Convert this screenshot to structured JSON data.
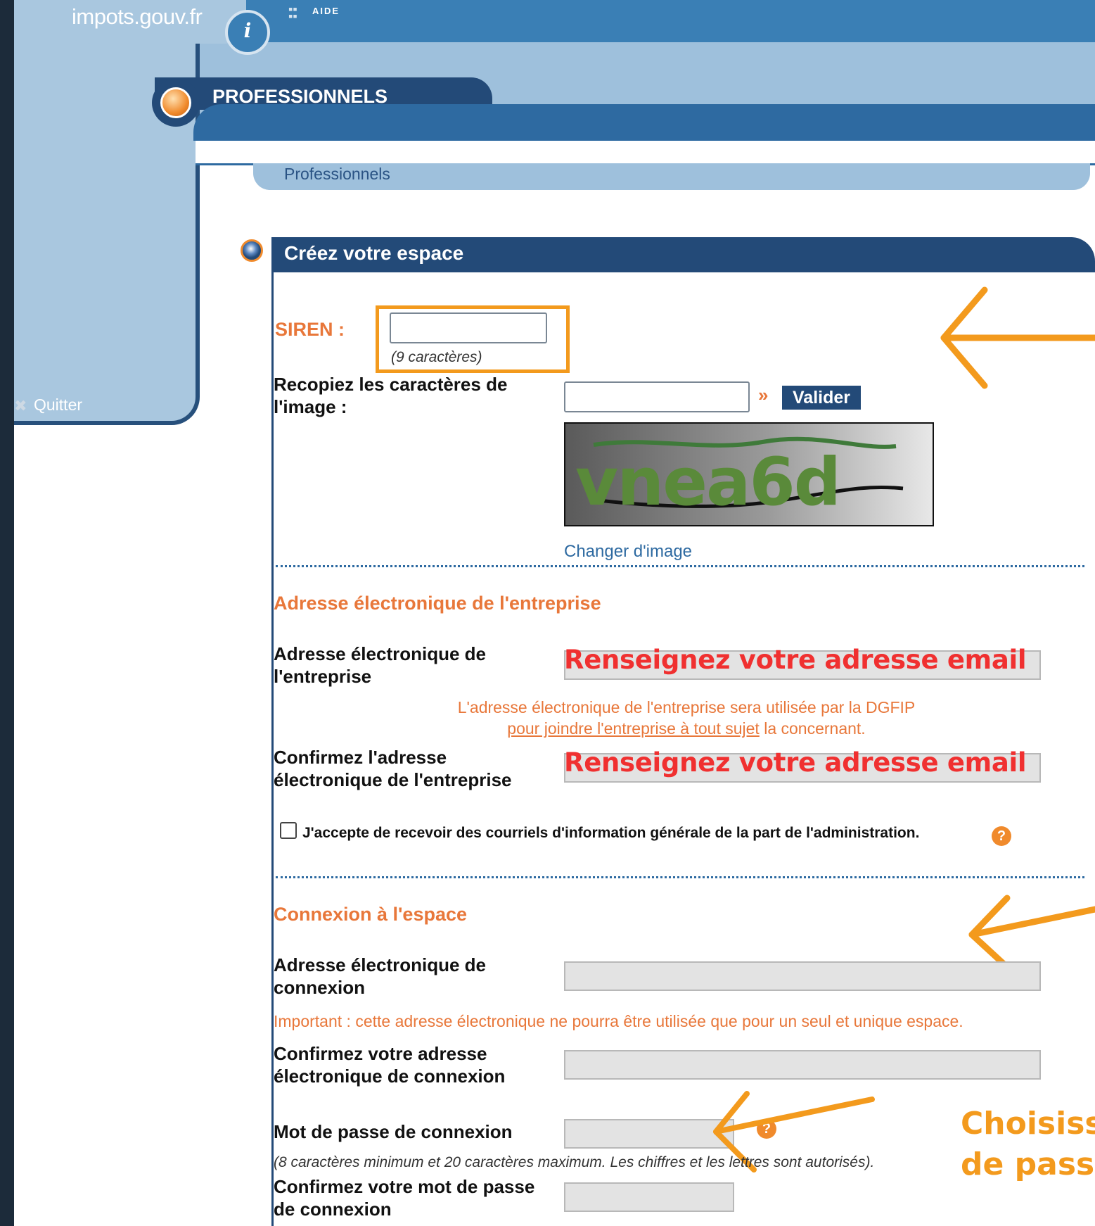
{
  "header": {
    "site_name": "impots.gouv.fr",
    "info_icon": "i",
    "aide_label": "AIDE",
    "section_label": "PROFESSIONNELS"
  },
  "breadcrumb": {
    "text": "Professionnels"
  },
  "sidebar": {
    "quit_label": "Quitter",
    "quit_icon": "✖"
  },
  "form": {
    "title": "Créez votre espace",
    "siren": {
      "label": "SIREN :",
      "value": "",
      "hint": "(9 caractères)"
    },
    "captcha": {
      "label_line1": "Recopiez les caractères de",
      "label_line2": "l'image :",
      "value": "",
      "validate_label": "Valider",
      "arrow_glyph": "»",
      "image_text": "vnea6d",
      "change_label": "Changer d'image"
    },
    "company_email_section": {
      "heading": "Adresse électronique de l'entreprise",
      "email_label_line1": "Adresse électronique de",
      "email_label_line2": "l'entreprise",
      "email_value": "",
      "note_line1": "L'adresse électronique de l'entreprise sera utilisée par la DGFIP",
      "note_link": "pour joindre l'entreprise à tout sujet",
      "note_line2_rest": " la concernant.",
      "confirm_label_line1": "Confirmez l'adresse",
      "confirm_label_line2": "électronique de l'entreprise",
      "confirm_value": "",
      "consent_label": "J'accepte de recevoir des courriels d'information générale de la part de l'administration.",
      "consent_checked": false,
      "help_glyph": "?"
    },
    "connection_section": {
      "heading": "Connexion à l'espace",
      "email_label_line1": "Adresse électronique de",
      "email_label_line2": "connexion",
      "email_value": "",
      "important_note": "Important : cette adresse électronique ne pourra être utilisée que pour un seul et unique espace.",
      "confirm_label_line1": "Confirmez votre adresse",
      "confirm_label_line2": "électronique de connexion",
      "confirm_value": "",
      "password_label": "Mot de passe de connexion",
      "password_value": "",
      "password_help": "?",
      "password_hint": "(8 caractères minimum et 20 caractères maximum. Les chiffres et les lettres sont autorisés).",
      "confirm_password_line1": "Confirmez votre mot de passe",
      "confirm_password_line2": "de connexion",
      "confirm_password_value": ""
    }
  },
  "annotations": {
    "email_overlay_1": "Renseignez votre adresse email",
    "email_overlay_2": "Renseignez votre adresse email",
    "password_callout_line1": "Choisiss",
    "password_callout_line2": "de pass",
    "color_highlight": "#f39a1d",
    "color_overlay_text": "#f03030"
  }
}
